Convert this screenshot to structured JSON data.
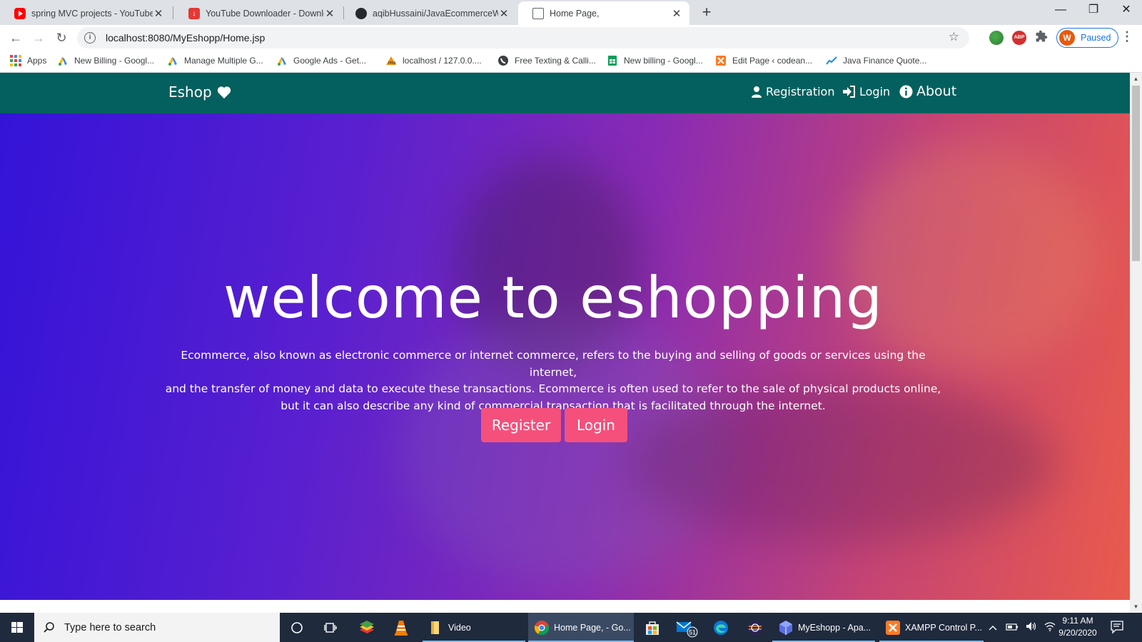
{
  "browser": {
    "tabs": [
      {
        "title": "spring MVC projects - YouTube",
        "icon": "youtube-icon",
        "active": false
      },
      {
        "title": "YouTube Downloader - Download",
        "icon": "downloader-icon",
        "active": false
      },
      {
        "title": "aqibHussaini/JavaEcommerceWe",
        "icon": "github-icon",
        "active": false
      },
      {
        "title": "Home Page,",
        "icon": "page-icon",
        "active": true
      }
    ],
    "new_tab": "+",
    "url": "localhost:8080/MyEshopp/Home.jsp",
    "profile_initial": "W",
    "profile_status": "Paused",
    "abp_label": "ABP",
    "bookmarks": [
      {
        "label": "Apps"
      },
      {
        "label": "New Billing - Googl..."
      },
      {
        "label": "Manage Multiple G..."
      },
      {
        "label": "Google Ads - Get..."
      },
      {
        "label": "localhost / 127.0.0...."
      },
      {
        "label": "Free Texting & Calli..."
      },
      {
        "label": "New billing - Googl..."
      },
      {
        "label": "Edit Page ‹ codean..."
      },
      {
        "label": "Java Finance Quote..."
      }
    ]
  },
  "site": {
    "brand": "Eshop",
    "nav": {
      "registration": "Registration",
      "login": "Login",
      "about": "About"
    },
    "hero": {
      "title": "welcome to eshopping",
      "description_lines": [
        "Ecommerce, also known as electronic commerce or internet commerce, refers to the buying and selling of goods or services using the internet,",
        "and the transfer of money and data to execute these transactions. Ecommerce is often used to refer to the sale of physical products online,",
        "but it can also describe any kind of commercial transaction that is facilitated through the internet."
      ],
      "register_button": "Register",
      "login_button": "Login"
    },
    "colors": {
      "navbar": "#03605e",
      "button": "#f5507c",
      "gradient_start": "#3413d8",
      "gradient_end": "#e95a4c"
    }
  },
  "taskbar": {
    "search_placeholder": "Type here to search",
    "apps": [
      {
        "label": "Video"
      },
      {
        "label": "Home Page, - Go..."
      },
      {
        "label": "MyEshopp - Apa..."
      },
      {
        "label": "XAMPP Control P..."
      }
    ],
    "mail_badge": "51",
    "time": "9:11 AM",
    "date": "9/20/2020"
  }
}
